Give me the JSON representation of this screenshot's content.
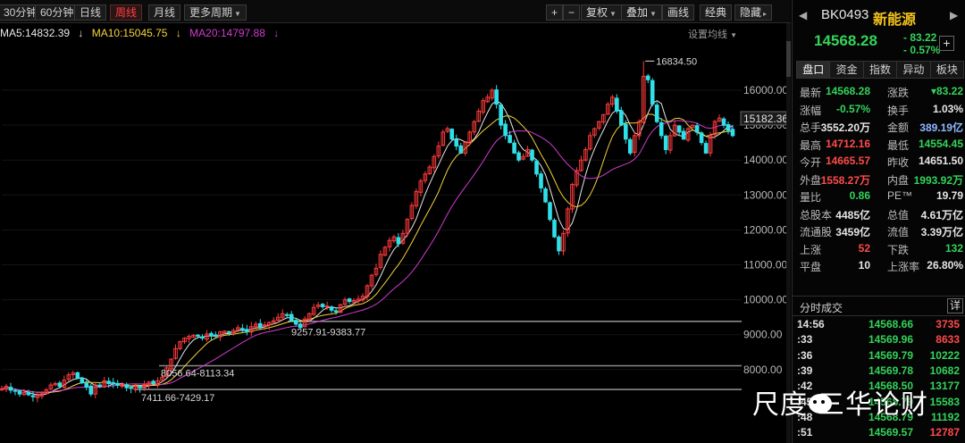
{
  "toolbar": {
    "periods": [
      "30分钟",
      "60分钟",
      "日线",
      "周线",
      "月线",
      "更多周期"
    ],
    "active_period": "周线",
    "zoom_in": "+",
    "zoom_out": "−",
    "fuquan": "复权",
    "diejia": "叠加",
    "huaxian": "画线",
    "jingdian": "经典",
    "yincang": "隐藏"
  },
  "ma_legend": {
    "ma5": "MA5:14832.39",
    "ma10": "MA10:15045.75",
    "ma20": "MA20:14797.88",
    "settings": "设置均线"
  },
  "colors": {
    "up": "#ff3b3b",
    "down": "#2fe0e8",
    "ma5": "#e8e8e8",
    "ma10": "#f3d33a",
    "ma20": "#d23bd0",
    "background": "#000000"
  },
  "chart_data": {
    "type": "candlestick",
    "period": "weekly",
    "ylim": [
      7000,
      17000
    ],
    "yticks": [
      8000,
      9000,
      10000,
      11000,
      12000,
      13000,
      14000,
      15000,
      16000
    ],
    "current_price_label": "15182.36",
    "series_close": [
      7450,
      7520,
      7410,
      7380,
      7300,
      7340,
      7280,
      7220,
      7260,
      7310,
      7420,
      7560,
      7600,
      7520,
      7700,
      7850,
      7900,
      7760,
      7620,
      7500,
      7300,
      7560,
      7520,
      7680,
      7600,
      7590,
      7550,
      7580,
      7480,
      7460,
      7530,
      7480,
      7560,
      7640,
      7600,
      7680,
      7780,
      8050,
      8300,
      8600,
      8800,
      8900,
      8950,
      8980,
      8960,
      8900,
      9020,
      8980,
      8950,
      9080,
      9100,
      9060,
      9120,
      9200,
      9150,
      9080,
      9230,
      9300,
      9220,
      9280,
      9350,
      9400,
      9500,
      9600,
      9550,
      9400,
      9300,
      9200,
      9450,
      9600,
      9780,
      9850,
      9800,
      9820,
      9700,
      9650,
      9860,
      10000,
      9950,
      9980,
      10020,
      10100,
      10400,
      10700,
      10900,
      11300,
      11500,
      11700,
      11800,
      11600,
      11900,
      12300,
      12700,
      13100,
      13400,
      13600,
      13800,
      14100,
      14400,
      14800,
      14900,
      14600,
      14400,
      14200,
      14500,
      14800,
      15100,
      15400,
      15700,
      15800,
      16000,
      15600,
      15000,
      14700,
      14500,
      14200,
      14000,
      14100,
      14300,
      14000,
      13600,
      13200,
      12800,
      12300,
      11800,
      11400,
      11900,
      12600,
      13300,
      13700,
      14000,
      14300,
      14700,
      14900,
      15100,
      15300,
      15600,
      15800,
      15400,
      15000,
      14600,
      14200,
      14700,
      15100,
      16400,
      16300,
      15600,
      15100,
      14700,
      14300,
      14700,
      15000,
      14800,
      14600,
      14900,
      15000,
      14800,
      14500,
      14200,
      14700,
      15100,
      15200,
      15000,
      14850,
      14700
    ],
    "annotations": [
      {
        "label": "16834.50"
      },
      {
        "label": "9257.91-9383.77"
      },
      {
        "label": "8056.64-8113.34"
      },
      {
        "label": "7411.66-7429.17"
      }
    ],
    "support_lines": [
      9380,
      8110,
      7430
    ]
  },
  "quote": {
    "code": "BK0493",
    "name": "新能源",
    "price": "14568.28",
    "change": "- 83.22",
    "change_pct": "- 0.57%",
    "plus": "+",
    "tabs": [
      "盘口",
      "资金",
      "指数",
      "异动",
      "板块"
    ],
    "rows": [
      [
        {
          "label": "最新",
          "value": "14568.28",
          "color": "green"
        },
        {
          "label": "涨跌",
          "value": "▾83.22",
          "color": "green"
        }
      ],
      [
        {
          "label": "涨幅",
          "value": "-0.57%",
          "color": "green"
        },
        {
          "label": "换手",
          "value": "1.03%",
          "color": "white"
        }
      ],
      [
        {
          "label": "总手",
          "value": "3552.20万",
          "color": "white"
        },
        {
          "label": "金额",
          "value": "389.19亿",
          "color": "blue"
        }
      ],
      [
        {
          "label": "最高",
          "value": "14712.16",
          "color": "red"
        },
        {
          "label": "最低",
          "value": "14554.45",
          "color": "green"
        }
      ],
      [
        {
          "label": "今开",
          "value": "14665.57",
          "color": "red"
        },
        {
          "label": "昨收",
          "value": "14651.50",
          "color": "white"
        }
      ],
      [
        {
          "label": "外盘",
          "value": "1558.27万",
          "color": "red"
        },
        {
          "label": "内盘",
          "value": "1993.92万",
          "color": "green"
        }
      ],
      [
        {
          "label": "量比",
          "value": "0.86",
          "color": "green"
        },
        {
          "label": "PE™",
          "value": "19.79",
          "color": "white"
        }
      ],
      [
        {
          "label": "总股本",
          "value": "4485亿",
          "color": "white"
        },
        {
          "label": "总值",
          "value": "4.61万亿",
          "color": "white"
        }
      ],
      [
        {
          "label": "流通股",
          "value": "3459亿",
          "color": "white"
        },
        {
          "label": "流值",
          "value": "3.39万亿",
          "color": "white"
        }
      ],
      [
        {
          "label": "上涨",
          "value": "52",
          "color": "red"
        },
        {
          "label": "下跌",
          "value": "132",
          "color": "green"
        }
      ],
      [
        {
          "label": "平盘",
          "value": "10",
          "color": "white"
        },
        {
          "label": "上涨率",
          "value": "26.80%",
          "color": "white"
        }
      ]
    ]
  },
  "ticks": {
    "title": "分时成交",
    "detail": "详",
    "rows": [
      {
        "time": "14:56",
        "price": "14568.66",
        "vol": "3735",
        "vol_color": "red"
      },
      {
        "time": ":33",
        "price": "14569.96",
        "vol": "8633",
        "vol_color": "red"
      },
      {
        "time": ":36",
        "price": "14569.79",
        "vol": "10222",
        "vol_color": "green"
      },
      {
        "time": ":39",
        "price": "14569.78",
        "vol": "10682",
        "vol_color": "green"
      },
      {
        "time": ":42",
        "price": "14568.50",
        "vol": "13177",
        "vol_color": "green"
      },
      {
        "time": ":45",
        "price": "14568.79",
        "vol": "15583",
        "vol_color": "green"
      },
      {
        "time": ":48",
        "price": "14568.79",
        "vol": "11192",
        "vol_color": "green"
      },
      {
        "time": ":51",
        "price": "14569.57",
        "vol": "12787",
        "vol_color": "red"
      }
    ]
  },
  "watermark": "尺度·三华论财"
}
